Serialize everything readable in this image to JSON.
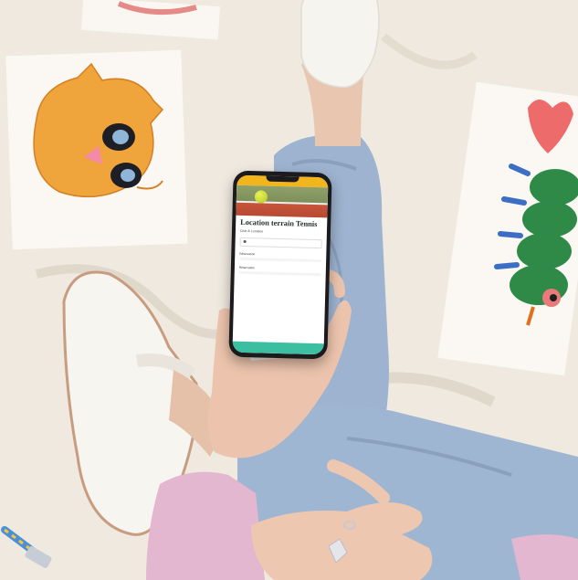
{
  "app": {
    "top_bar_text": "",
    "page_title": "Location terrain Tennis",
    "page_subtitle": "Club & Location",
    "field_label": "",
    "location_value": "",
    "section_label": "",
    "slot_group_1": {
      "title": "Réservation",
      "rows": [
        {
          "time": "",
          "price": ""
        },
        {
          "time": "",
          "price": ""
        }
      ]
    },
    "slot_group_2": {
      "title": "Réservation",
      "rows": [
        {
          "time": "",
          "price": ""
        }
      ]
    },
    "cta_label": ""
  },
  "colors": {
    "top_bar": "#f2b51c",
    "cta": "#3cbfa1"
  }
}
